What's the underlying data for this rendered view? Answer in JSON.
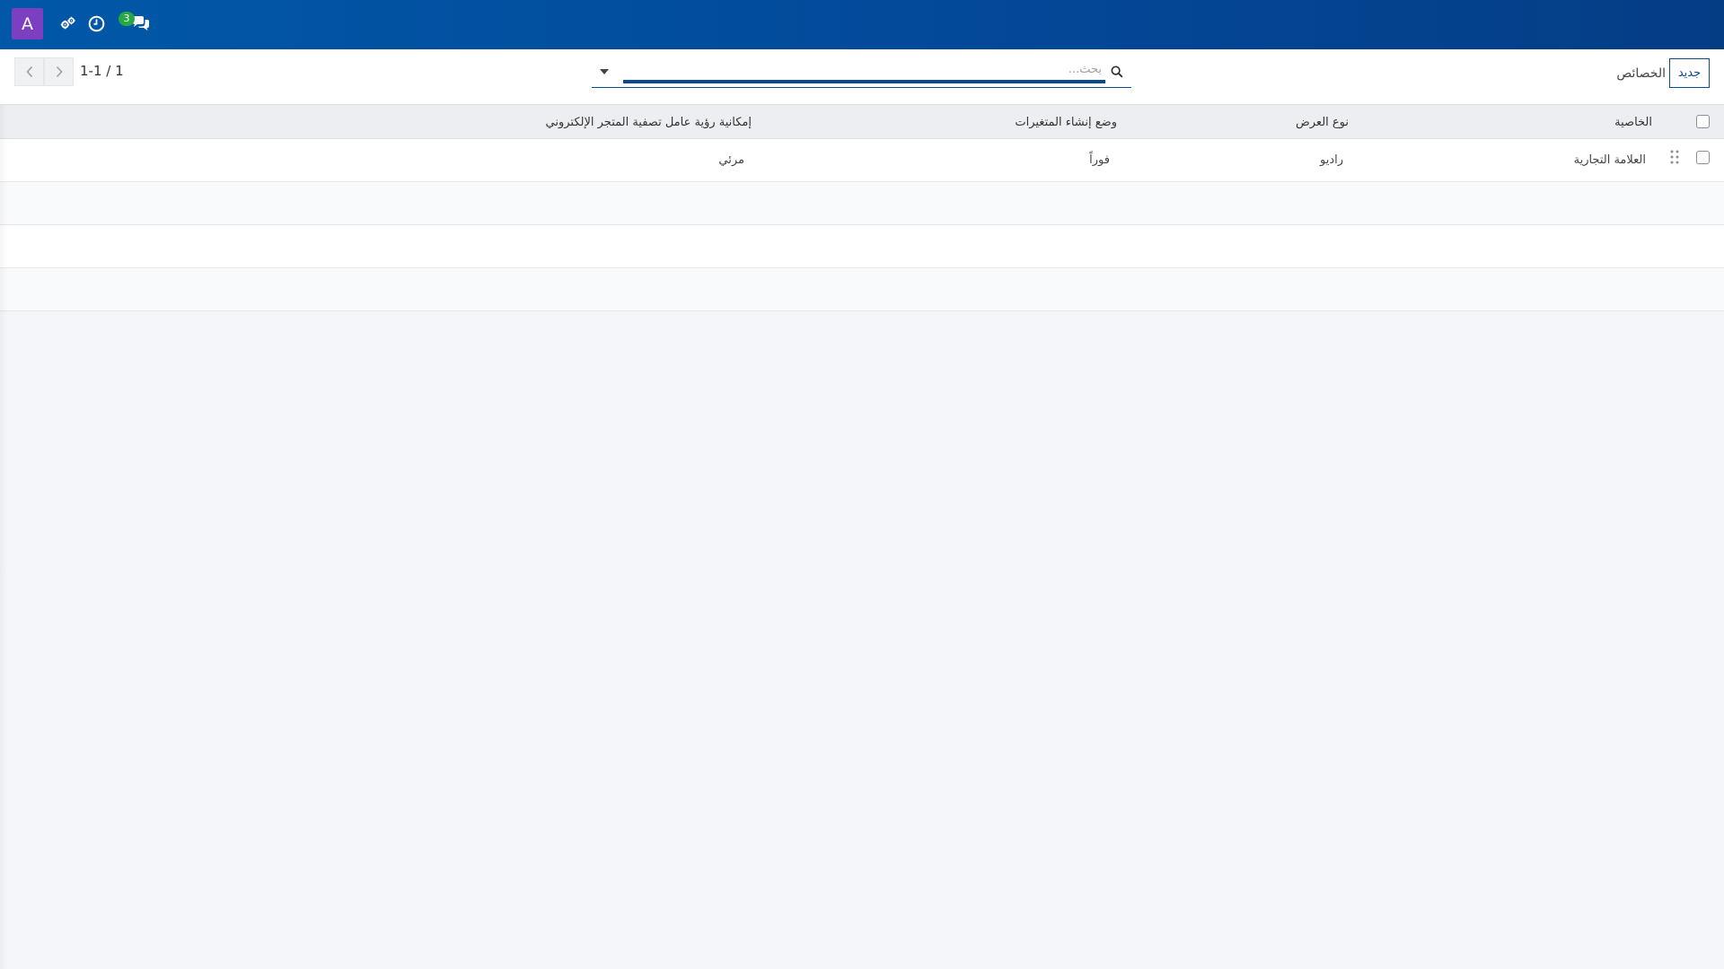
{
  "navbar": {
    "avatar_letter": "A",
    "icons": [
      "user-settings-icon",
      "clock-icon",
      "chat-icon"
    ],
    "chat_badge_count": "3",
    "colors": {
      "navbar": "#03499a",
      "avatar": "#7d3fc1",
      "badge": "#28a745"
    }
  },
  "control_panel": {
    "breadcrumb": "الخصائص",
    "new_button_label": "جديد",
    "search": {
      "placeholder": "بحث...",
      "value": ""
    },
    "pager": {
      "value": "1-1 / 1"
    }
  },
  "table": {
    "columns": [
      "الخاصية",
      "نوع العرض",
      "وضع إنشاء المتغيرات",
      "إمكانية رؤية عامل تصفية المتجر الإلكتروني"
    ],
    "rows": [
      {
        "attribute": "العلامة التجارية",
        "display_type": "راديو",
        "variant_creation": "فوراً",
        "ecommerce_filter_visibility": "مرئي"
      }
    ],
    "empty_rows": 3
  }
}
